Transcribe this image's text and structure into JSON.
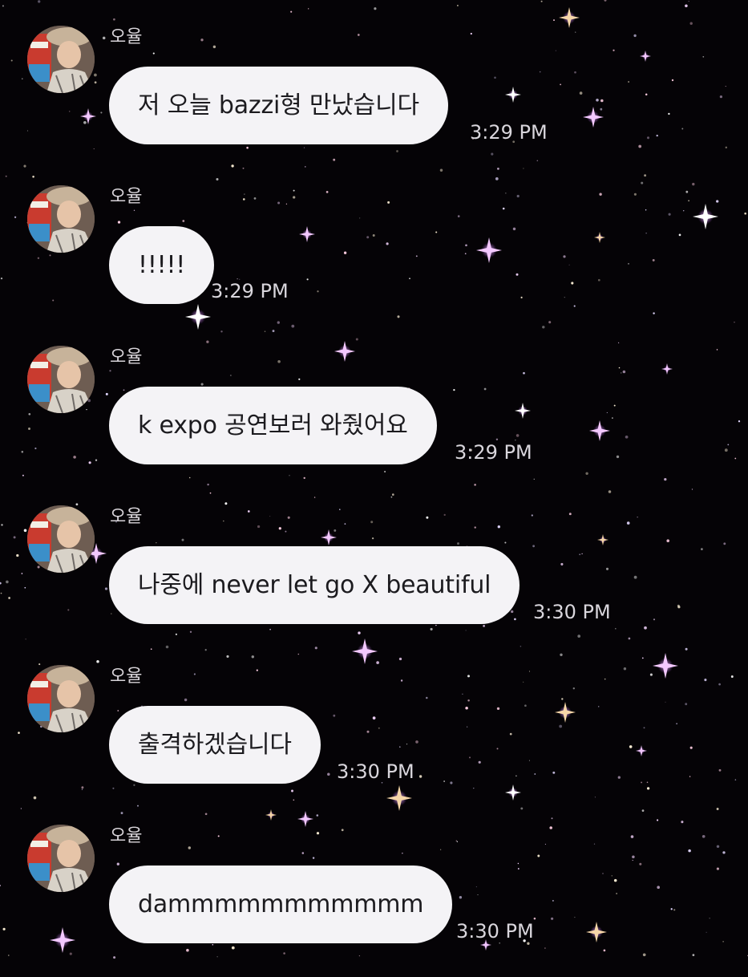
{
  "chat": {
    "sender": "오율",
    "messages": [
      {
        "text": "저 오늘 bazzi형 만났습니다",
        "time": "3:29 PM"
      },
      {
        "text": "!!!!!",
        "time": "3:29 PM"
      },
      {
        "text": "k expo 공연보러 와줬어요",
        "time": "3:29 PM"
      },
      {
        "text": "나중에 never let go X beautiful",
        "time": "3:30 PM"
      },
      {
        "text": "출격하겠습니다",
        "time": "3:30 PM"
      },
      {
        "text": "dammmmmmmmmmm",
        "time": "3:30 PM"
      }
    ]
  },
  "theme": {
    "background": "#050306",
    "bubble": "#f4f3f6",
    "bubble_text": "#1c1b1f",
    "meta_text": "#d9d6dc",
    "sparkle_pink": "#f3c8ff",
    "sparkle_white": "#ffffff",
    "sparkle_gold": "#f6d6a8"
  },
  "icons": {
    "avatar": "profile-photo",
    "background": "starry-night-sparkles"
  }
}
